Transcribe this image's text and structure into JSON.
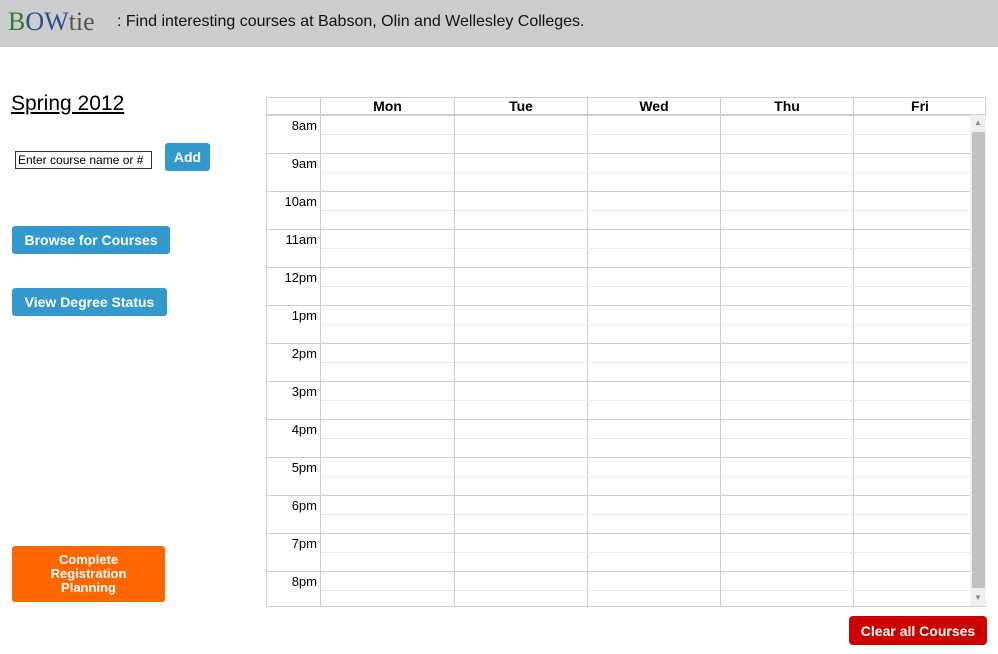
{
  "header": {
    "logo": {
      "b": "B",
      "ow": "OW",
      "tie": "tie"
    },
    "tagline": " : Find interesting courses at Babson, Olin and Wellesley Colleges."
  },
  "sidebar": {
    "term": "Spring 2012",
    "course_input_placeholder": "Enter course name or #",
    "add_label": "Add",
    "browse_label": "Browse for Courses",
    "degree_label": "View Degree Status",
    "complete_label": "Complete Registration Planning"
  },
  "calendar": {
    "days": [
      "Mon",
      "Tue",
      "Wed",
      "Thu",
      "Fri"
    ],
    "times": [
      "8am",
      "9am",
      "10am",
      "11am",
      "12pm",
      "1pm",
      "2pm",
      "3pm",
      "4pm",
      "5pm",
      "6pm",
      "7pm",
      "8pm"
    ]
  },
  "footer": {
    "clear_label": "Clear all Courses"
  },
  "colors": {
    "header_bg": "#cccccc",
    "button_blue": "#3399cc",
    "button_orange": "#ff6600",
    "button_red": "#cc0000"
  },
  "icons": {
    "scroll_up": "arrow-up-icon",
    "scroll_down": "arrow-down-icon"
  }
}
